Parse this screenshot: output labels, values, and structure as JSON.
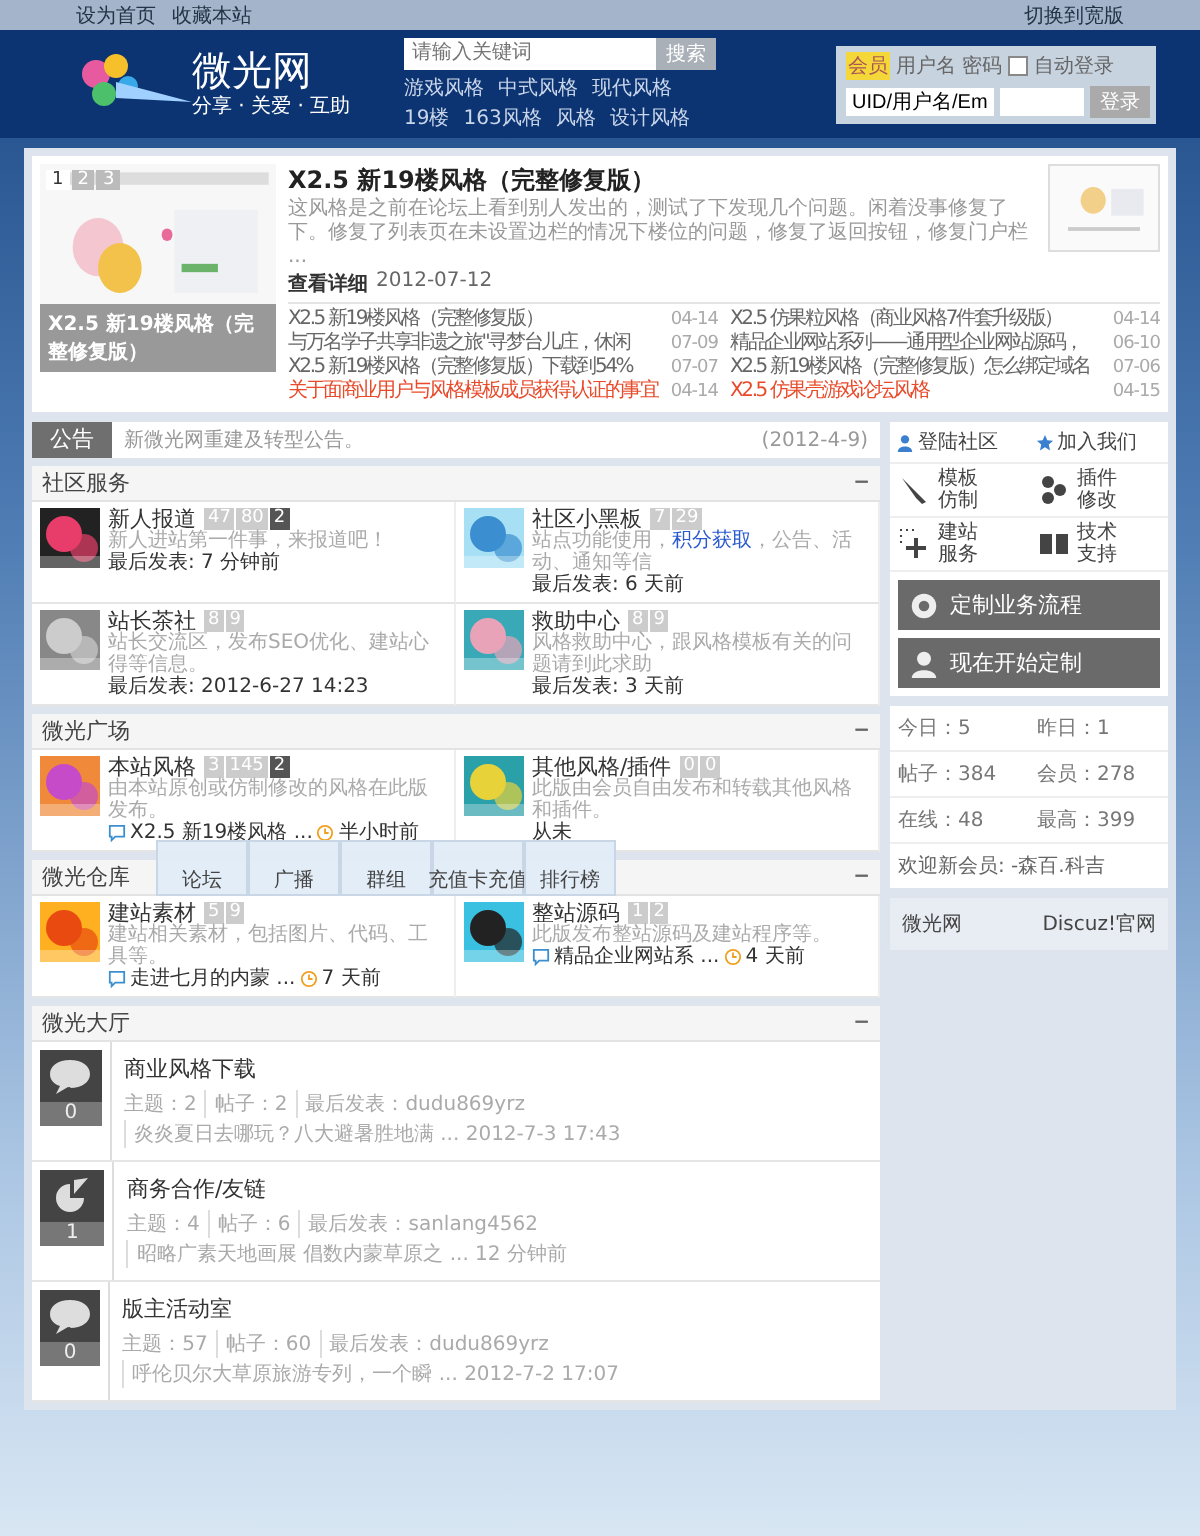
{
  "top_bar": {
    "links": [
      "设为首页",
      "收藏本站"
    ],
    "switch": "切换到宽版"
  },
  "header": {
    "logo": {
      "name": "微光网",
      "slogan": "分享 · 关爱 · 互助"
    },
    "search": {
      "placeholder": "请输入关键词",
      "button": "搜索",
      "hot_tags": [
        "游戏风格",
        "中式风格",
        "现代风格",
        "19楼",
        "163风格",
        "风格",
        "设计风格"
      ]
    },
    "login": {
      "badge": "会员",
      "username_label": "用户名",
      "password_label": "密码",
      "auto_login": {
        "label": "自动登录",
        "checked": false
      },
      "username_field": {
        "value": "UID/用户名/Em"
      },
      "button": "登录"
    }
  },
  "featured": {
    "slide": {
      "caption": "X2.5 新19楼风格（完整修复版）",
      "pages": [
        {
          "label": "1",
          "selected": true
        },
        {
          "label": "2",
          "selected": false
        },
        {
          "label": "3",
          "selected": false
        }
      ]
    },
    "headline": {
      "title": "X2.5 新19楼风格（完整修复版）",
      "summary": "这风格是之前在论坛上看到别人发出的，测试了下发现几个问题。闲着没事修复了下。修复了列表页在未设置边栏的情况下楼位的问题，修复了返回按钮，修复门户栏 ...",
      "more": "查看详细",
      "date": "2012-07-12"
    },
    "news": [
      {
        "title": "X2.5 新19楼风格（完整修复版）",
        "date": "04-14",
        "highlight": false
      },
      {
        "title": "X2.5 仿果粒风格（商业风格7件套升级版）",
        "date": "04-14",
        "highlight": false
      },
      {
        "title": "与万名学子共享非遗之旅\"寻梦台儿庄，休闲",
        "date": "07-09",
        "highlight": false
      },
      {
        "title": "精品企业网站系列——通用型企业网站源码，",
        "date": "06-10",
        "highlight": false
      },
      {
        "title": "X2.5 新19楼风格（完整修复版）下载到54%",
        "date": "07-07",
        "highlight": false
      },
      {
        "title": "X2.5 新19楼风格（完整修复版）怎么绑定域名",
        "date": "07-06",
        "highlight": false
      },
      {
        "title": "关于面商业用户与风格模板成员获得认证的事宜",
        "date": "04-14",
        "highlight": true
      },
      {
        "title": "X2.5 仿果壳游戏论坛风格",
        "date": "04-15",
        "highlight": true
      }
    ]
  },
  "announcement": {
    "label": "公告",
    "text": "新微光网重建及转型公告。",
    "date": "(2012-4-9)"
  },
  "sections": [
    {
      "title": "社区服务",
      "collapse": "−",
      "forums": [
        {
          "name": "新人报道",
          "stats": [
            "47",
            "80"
          ],
          "today": "2",
          "desc": [
            {
              "text": "新人进站第一件事，来报道吧！",
              "link": false
            }
          ],
          "last": "最后发表: 7 分钟前"
        },
        {
          "name": "社区小黑板",
          "stats": [
            "7",
            "29"
          ],
          "desc": [
            {
              "text": "站点功能使用，",
              "link": false
            },
            {
              "text": "积分获取",
              "link": true
            },
            {
              "text": "，公告、活动、通知等信",
              "link": false
            }
          ],
          "last": "最后发表: 6 天前"
        },
        {
          "name": "站长茶社",
          "stats": [
            "8",
            "9"
          ],
          "desc": [
            {
              "text": "站长交流区，发布SEO优化、建站心得等信息。",
              "link": false
            }
          ],
          "last": "最后发表: 2012-6-27 14:23"
        },
        {
          "name": "救助中心",
          "stats": [
            "8",
            "9"
          ],
          "desc": [
            {
              "text": "风格救助中心，跟风格模板有关的问题请到此求助",
              "link": false
            }
          ],
          "last": "最后发表: 3 天前"
        }
      ]
    },
    {
      "title": "微光广场",
      "collapse": "−",
      "forums": [
        {
          "name": "本站风格",
          "stats": [
            "3",
            "145"
          ],
          "today": "2",
          "desc": [
            {
              "text": "由本站原创或仿制修改的风格在此版发布。",
              "link": false
            }
          ],
          "thread": "X2.5 新19楼风格 ...",
          "time": "半小时前"
        },
        {
          "name": "其他风格/插件",
          "stats": [
            "0",
            "0"
          ],
          "desc": [
            {
              "text": "此版由会员自由发布和转载其他风格和插件。",
              "link": false
            }
          ],
          "last": "从未"
        }
      ]
    },
    {
      "title": "微光仓库",
      "collapse": "−",
      "menu": [
        "论坛",
        "广播",
        "群组",
        "充值卡充值",
        "排行榜"
      ],
      "forums": [
        {
          "name": "建站素材",
          "stats": [
            "5",
            "9"
          ],
          "desc": [
            {
              "text": "建站相关素材，包括图片、代码、工具等。",
              "link": false
            }
          ],
          "thread": "走进七月的内蒙 ...",
          "time": "7 天前"
        },
        {
          "name": "整站源码",
          "stats": [
            "1",
            "2"
          ],
          "desc": [
            {
              "text": "此版发布整站源码及建站程序等。",
              "link": false
            }
          ],
          "thread": "精品企业网站系 ...",
          "time": "4 天前"
        }
      ]
    }
  ],
  "hall": {
    "title": "微光大厅",
    "collapse": "−",
    "rows": [
      {
        "name": "商业风格下载",
        "kind": "bubble",
        "new": "0",
        "meta": [
          "主题：2",
          "帖子：2",
          "最后发表：dudu869yrz",
          "炎炎夏日去哪玩？八大避暑胜地满 ... 2012-7-3 17:43"
        ]
      },
      {
        "name": "商务合作/友链",
        "kind": "pie",
        "new": "1",
        "meta": [
          "主题：4",
          "帖子：6",
          "最后发表：sanlang4562",
          "昭略广素天地画展 倡数内蒙草原之 ... 12 分钟前"
        ]
      },
      {
        "name": "版主活动室",
        "kind": "bubble",
        "new": "0",
        "meta": [
          "主题：57",
          "帖子：60",
          "最后发表：dudu869yrz",
          "呼伦贝尔大草原旅游专列，一个瞬 ... 2012-7-2 17:07"
        ]
      }
    ]
  },
  "sidebar": {
    "quick": [
      "登陆社区",
      "加入我们"
    ],
    "services": [
      "模板仿制",
      "插件修改",
      "建站服务",
      "技术支持"
    ],
    "big_buttons": [
      "定制业务流程",
      "现在开始定制"
    ],
    "stats": [
      "今日：5",
      "昨日：1",
      "帖子：384",
      "会员：278",
      "在线：48",
      "最高：399"
    ],
    "welcome": "欢迎新会员: -森百.科吉",
    "links": [
      "微光网",
      "Discuz!官网"
    ]
  }
}
